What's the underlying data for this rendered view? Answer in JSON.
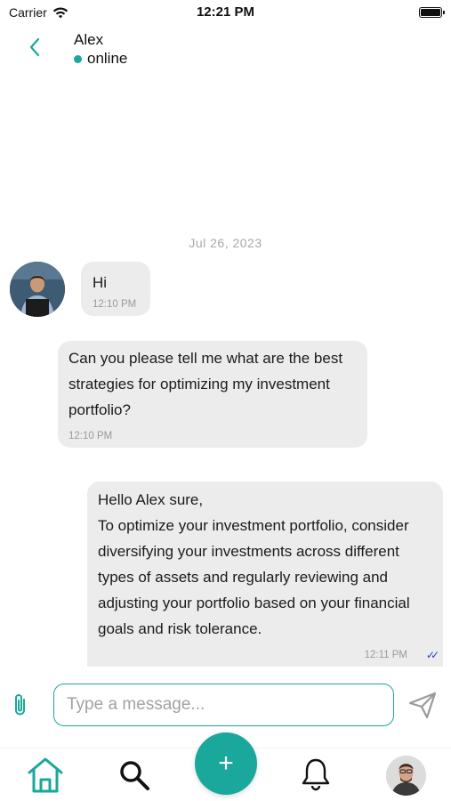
{
  "status_bar": {
    "carrier": "Carrier",
    "time": "12:21 PM"
  },
  "header": {
    "contact_name": "Alex",
    "presence": "online",
    "presence_color": "#1aa79c",
    "back_icon": "chevron-left-icon"
  },
  "conversation": {
    "date": "Jul 26, 2023",
    "messages": [
      {
        "sender": "Alex",
        "text": "Hi",
        "time": "12:10 PM"
      },
      {
        "sender": "Alex",
        "lines": [
          "Can you please tell me what are the best",
          "strategies for optimizing my investment",
          "portfolio?"
        ],
        "time": "12:10 PM"
      },
      {
        "sender": "me",
        "lines": [
          "Hello Alex sure,",
          "To optimize your investment portfolio, consider",
          "diversifying your investments across different",
          "types of assets and regularly reviewing and",
          "adjusting your portfolio based on your financial",
          "goals and risk tolerance."
        ],
        "time": "12:11 PM",
        "status_icon": "double-check-icon"
      }
    ]
  },
  "composer": {
    "placeholder": "Type a message...",
    "attach_icon": "paperclip-icon",
    "send_icon": "send-icon"
  },
  "nav": {
    "fab_label": "+",
    "items": [
      "home-icon",
      "search-icon",
      "bell-icon",
      "profile-avatar"
    ]
  },
  "colors": {
    "accent": "#1aa79c",
    "bubble": "#ececec",
    "read_receipt": "#2345c9"
  }
}
